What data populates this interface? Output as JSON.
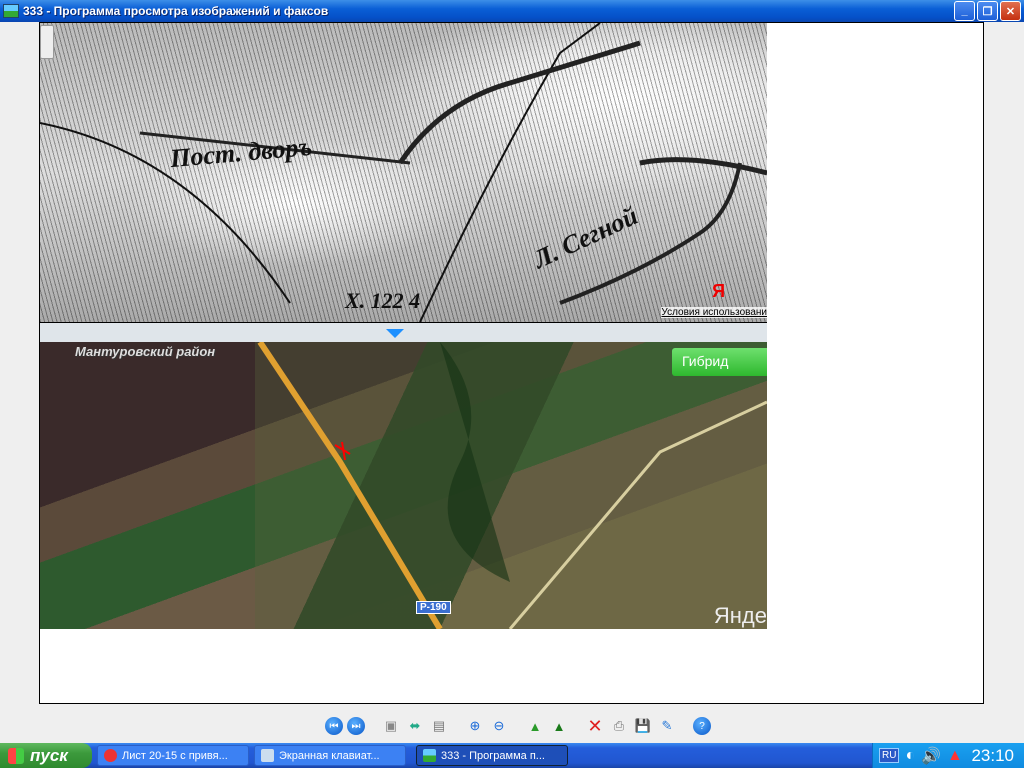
{
  "window": {
    "title": "333 - Программа просмотра изображений и факсов",
    "minimize": "_",
    "maximize": "❐",
    "close": "✕"
  },
  "oldmap": {
    "labels": [
      "Пост. дворъ",
      "Л. Сегной",
      "Х. 122 4"
    ],
    "logo": "Я",
    "terms": "Условия использовани"
  },
  "satellite": {
    "district": "Мантуровский район",
    "hybrid_button": "Гибрид",
    "road_label": "Р-190",
    "watermark": "Янде"
  },
  "toolbar": {
    "icons": [
      "previous-image",
      "next-image",
      "best-fit",
      "actual-size",
      "slideshow",
      "zoom-in",
      "zoom-out",
      "rotate-clockwise",
      "rotate-counterclockwise",
      "delete",
      "print",
      "save",
      "edit",
      "help"
    ]
  },
  "taskbar": {
    "start": "пуск",
    "tasks": [
      {
        "label": "Лист 20-15 с привя...",
        "icon": "yandex-browser"
      },
      {
        "label": "Экранная клавиат...",
        "icon": "keyboard"
      },
      {
        "label": "333 - Программа п...",
        "icon": "image-viewer"
      }
    ],
    "language": "RU",
    "time": "23:10"
  }
}
